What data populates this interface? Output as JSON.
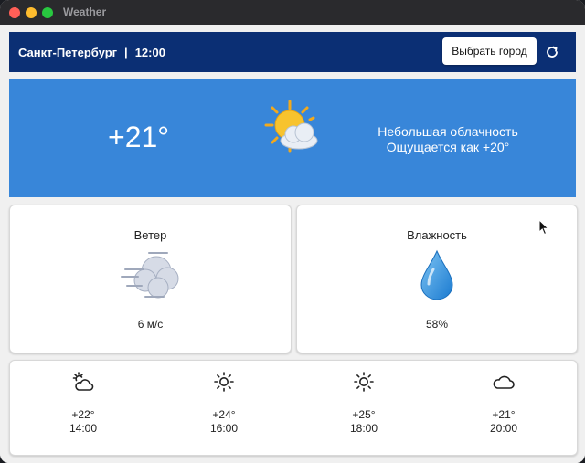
{
  "window": {
    "title": "Weather"
  },
  "header": {
    "city": "Санкт-Петербург",
    "time": "12:00",
    "choose_city_label": "Выбрать город"
  },
  "current": {
    "temperature": "+21°",
    "description": "Небольшая облачность",
    "feels_like": "Ощущается как +20°"
  },
  "wind": {
    "label": "Ветер",
    "value": "6 м/с"
  },
  "humidity": {
    "label": "Влажность",
    "value": "58%"
  },
  "forecast": [
    {
      "temp": "+22°",
      "time": "14:00",
      "icon": "partly-cloudy-icon"
    },
    {
      "temp": "+24°",
      "time": "16:00",
      "icon": "sun-icon"
    },
    {
      "temp": "+25°",
      "time": "18:00",
      "icon": "sun-icon"
    },
    {
      "temp": "+21°",
      "time": "20:00",
      "icon": "cloud-icon"
    }
  ],
  "colors": {
    "header": "#0b2f74",
    "hero": "#3886d9",
    "background": "#f0f0f0"
  }
}
